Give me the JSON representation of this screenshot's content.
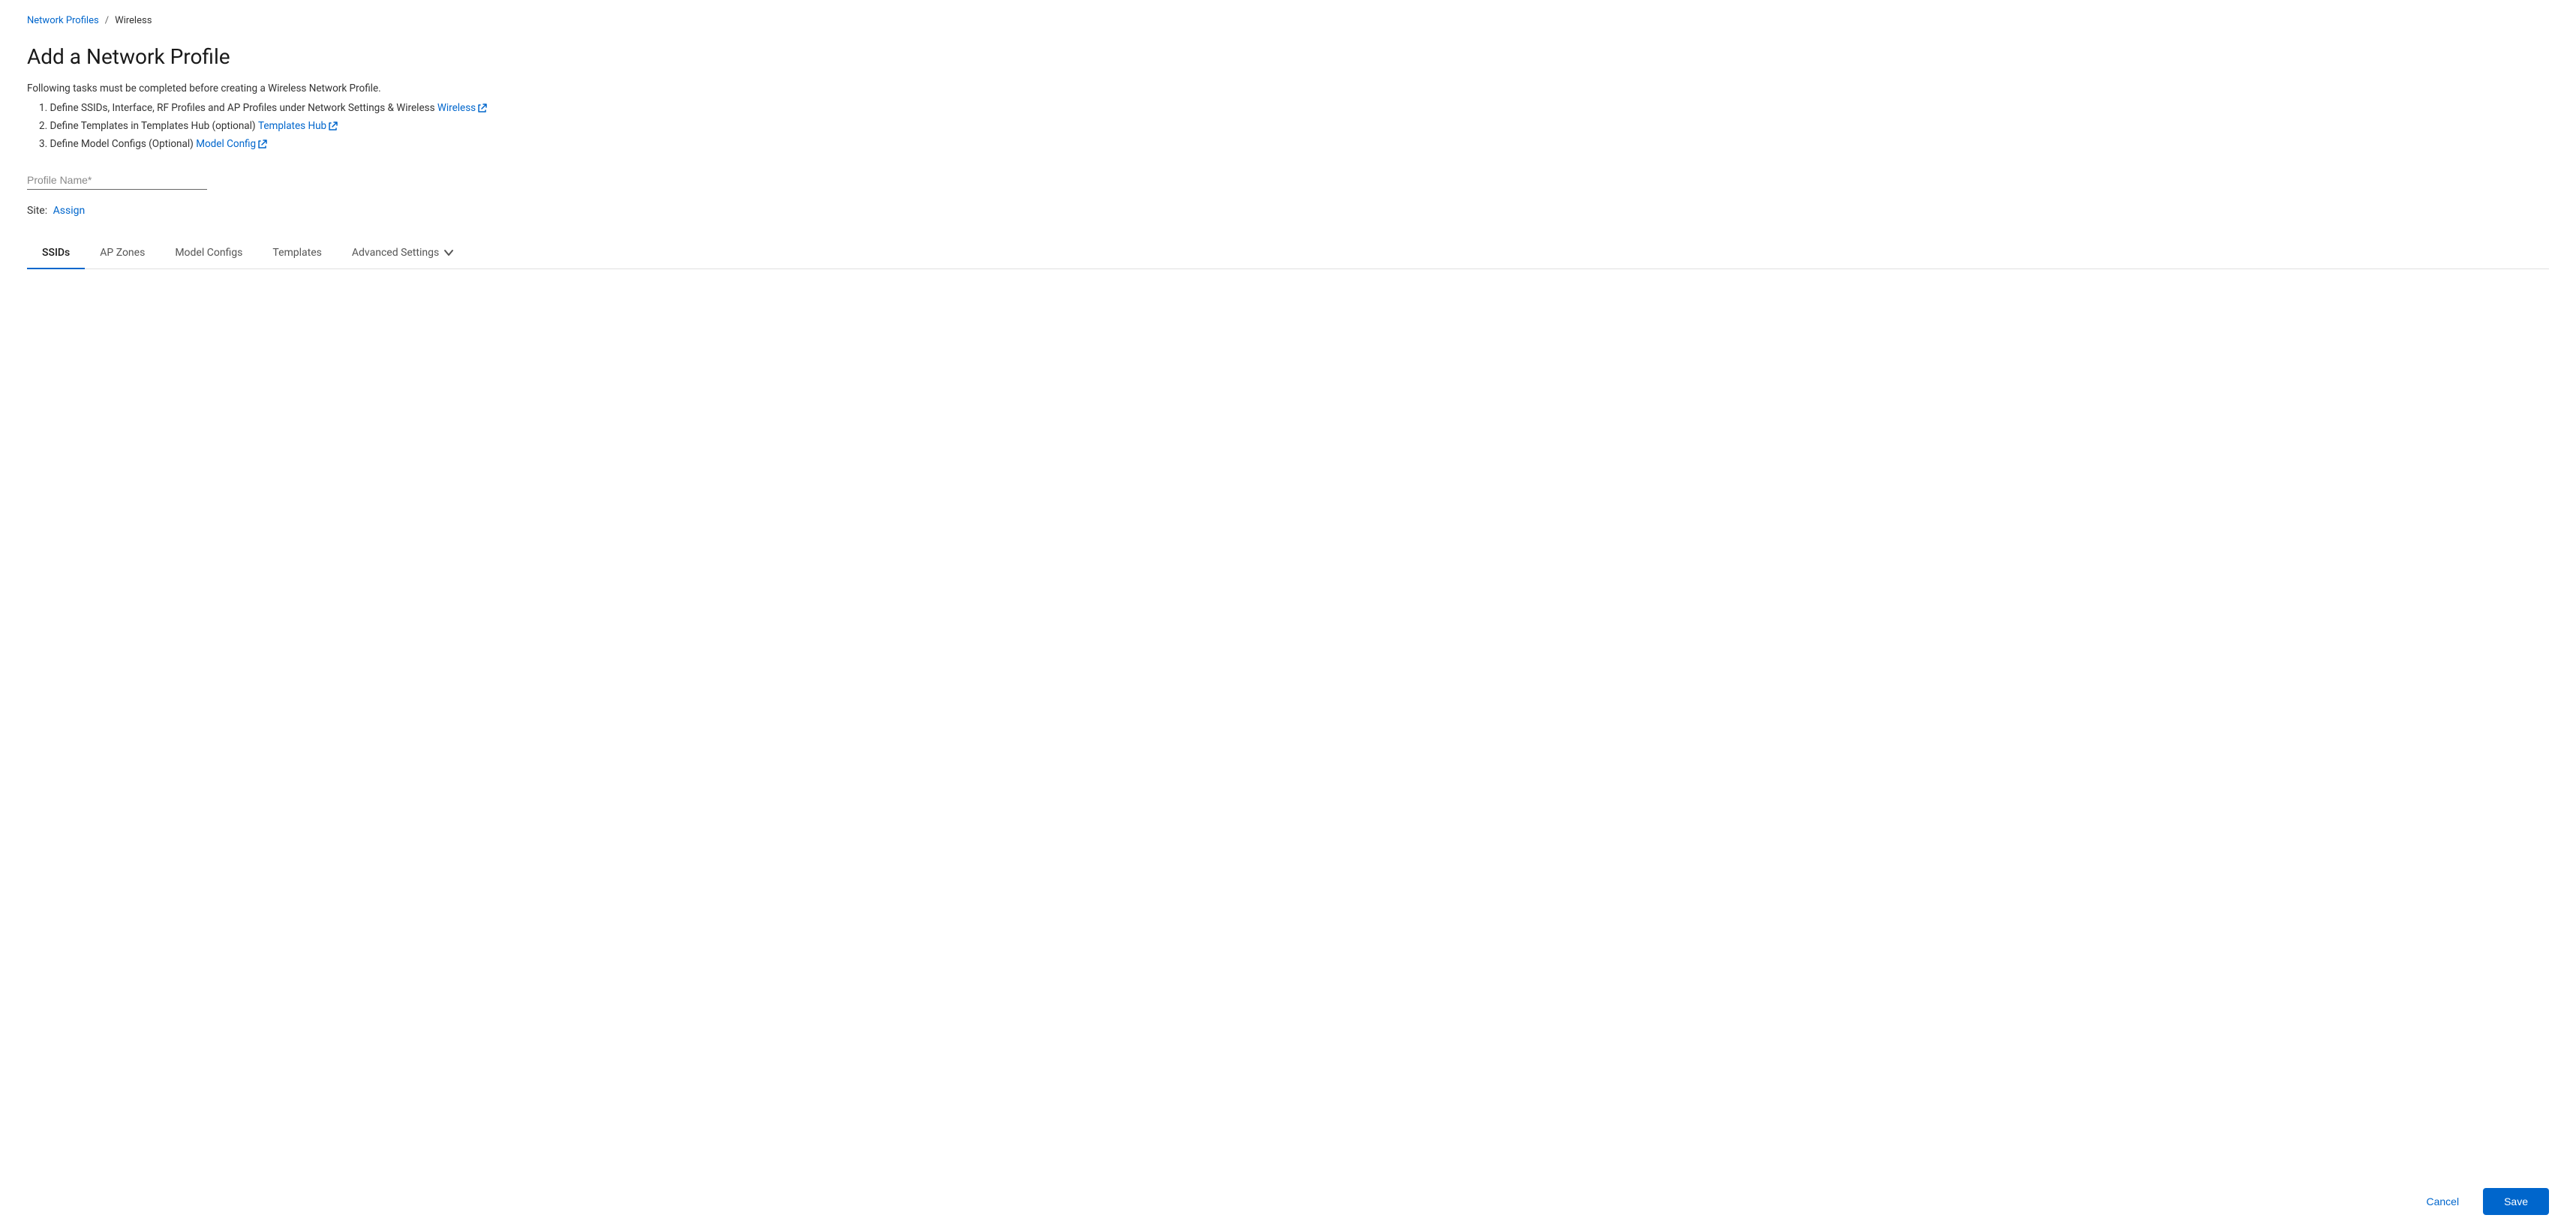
{
  "breadcrumb": {
    "parent_label": "Network Profiles",
    "separator": "/",
    "current": "Wireless"
  },
  "page": {
    "title": "Add a Network Profile",
    "instructions_prefix": "Following tasks must be completed before creating a Wireless Network Profile.",
    "steps": [
      {
        "number": "1.",
        "text_before": "Define SSIDs, Interface, RF Profiles and AP Profiles under Network Settings & Wireless",
        "link_label": "Wireless",
        "text_after": ""
      },
      {
        "number": "2.",
        "text_before": "Define Templates in Templates Hub (optional)",
        "link_label": "Templates Hub",
        "text_after": ""
      },
      {
        "number": "3.",
        "text_before": "Define Model Configs (Optional)",
        "link_label": "Model Config",
        "text_after": ""
      }
    ]
  },
  "form": {
    "profile_name_placeholder": "Profile Name*",
    "site_label": "Site:",
    "site_assign_label": "Assign"
  },
  "tabs": [
    {
      "id": "ssids",
      "label": "SSIDs",
      "active": true
    },
    {
      "id": "ap-zones",
      "label": "AP Zones",
      "active": false
    },
    {
      "id": "model-configs",
      "label": "Model Configs",
      "active": false
    },
    {
      "id": "templates",
      "label": "Templates",
      "active": false
    },
    {
      "id": "advanced-settings",
      "label": "Advanced Settings",
      "active": false,
      "has_chevron": true
    }
  ],
  "actions": {
    "cancel_label": "Cancel",
    "save_label": "Save"
  },
  "colors": {
    "accent": "#0066cc",
    "tab_active_border": "#0066cc"
  }
}
